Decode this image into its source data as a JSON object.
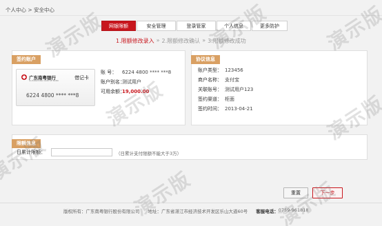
{
  "breadcrumb": "个人中心 > 安全中心",
  "tabs": [
    "网银限额",
    "安全管理",
    "登录管家",
    "个人信息",
    "更多防护"
  ],
  "steps": [
    "1.限额修改录入",
    "2.限额修改确认",
    "3.限额修改成功"
  ],
  "step_separator": "»",
  "account_panel": {
    "title": "签约账户",
    "card": {
      "bank_name": "广东南粤银行",
      "bank_name_en": "GUANGDONG NANYUE BANK",
      "card_type": "借记卡",
      "card_number": "6224 4800 **** ***8"
    },
    "fields": [
      {
        "label": "账      号：",
        "value": "6224 4800 **** ***8"
      },
      {
        "label": "账户别名：",
        "value": "测试用户"
      },
      {
        "label": "可用余额：",
        "value": "19,000.00"
      }
    ]
  },
  "agreement_panel": {
    "title": "协议信息",
    "fields": [
      {
        "label": "账户类型：",
        "value": "123456"
      },
      {
        "label": "商户名称：",
        "value": "支付宝"
      },
      {
        "label": "关联账号：",
        "value": "测试用户123"
      },
      {
        "label": "签约渠道：",
        "value": "柜面"
      },
      {
        "label": "签约时间：",
        "value": "2013-04-21"
      }
    ]
  },
  "limit_panel": {
    "title": "限额信息",
    "label": "日累计限额：",
    "input_value": "",
    "hint": "（日累计支付限额不能大于3万）"
  },
  "buttons": {
    "reset": "重置",
    "next": "下一步"
  },
  "footer": {
    "copyright": "版权所有：广东南粤银行股份有限公司",
    "address": "地址：广东省湛江市经济技术开发区乐山大道60号",
    "hotline_label": "客服电话：",
    "hotline": "0759-961818"
  },
  "watermark": "演示版",
  "colors": {
    "accent": "#c8161d",
    "panel_head": "#d9a063",
    "background": "#f2f2f2"
  }
}
